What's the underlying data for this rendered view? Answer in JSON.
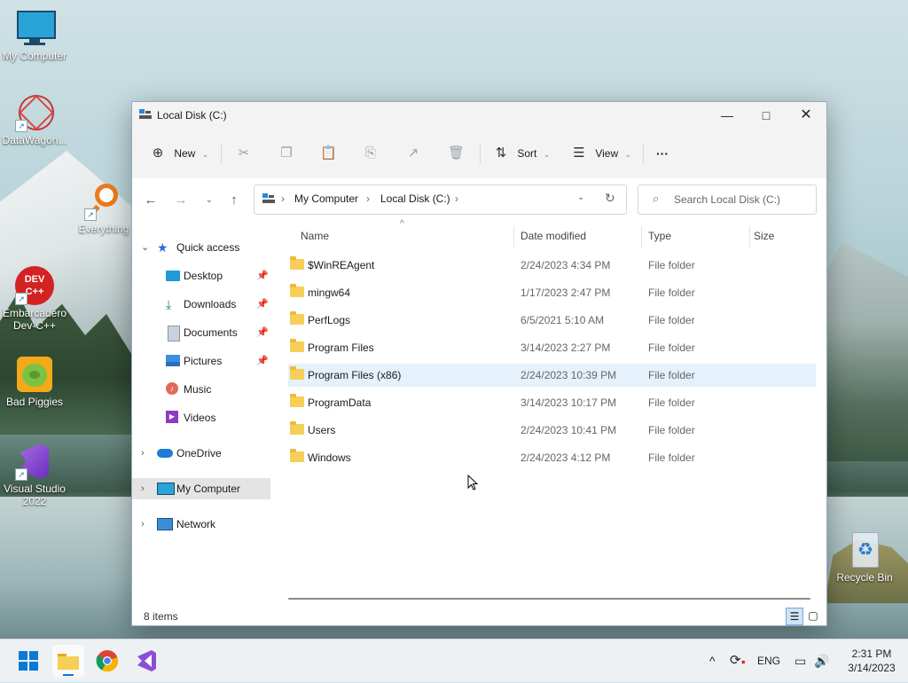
{
  "desktop": {
    "icons": [
      {
        "label": "My Computer"
      },
      {
        "label": "DataWagon..."
      },
      {
        "label": "Everything"
      },
      {
        "label": "Embarcadero Dev-C++"
      },
      {
        "label": "Bad Piggies"
      },
      {
        "label": "Visual Studio 2022"
      },
      {
        "label": "Recycle Bin"
      }
    ]
  },
  "window": {
    "title": "Local Disk (C:)",
    "toolbar": {
      "new_label": "New",
      "sort_label": "Sort",
      "view_label": "View",
      "more_label": "···"
    },
    "address": {
      "crumbs": [
        "My Computer",
        "Local Disk (C:)"
      ],
      "search_placeholder": "Search Local Disk (C:)"
    },
    "sidebar": {
      "quick_access": "Quick access",
      "items": [
        {
          "label": "Desktop",
          "pinned": true
        },
        {
          "label": "Downloads",
          "pinned": true
        },
        {
          "label": "Documents",
          "pinned": true
        },
        {
          "label": "Pictures",
          "pinned": true
        },
        {
          "label": "Music",
          "pinned": false
        },
        {
          "label": "Videos",
          "pinned": false
        }
      ],
      "onedrive": "OneDrive",
      "my_computer": "My Computer",
      "network": "Network"
    },
    "columns": [
      "Name",
      "Date modified",
      "Type",
      "Size"
    ],
    "rows": [
      {
        "name": "$WinREAgent",
        "date": "2/24/2023 4:34 PM",
        "type": "File folder"
      },
      {
        "name": "mingw64",
        "date": "1/17/2023 2:47 PM",
        "type": "File folder"
      },
      {
        "name": "PerfLogs",
        "date": "6/5/2021 5:10 AM",
        "type": "File folder"
      },
      {
        "name": "Program Files",
        "date": "3/14/2023 2:27 PM",
        "type": "File folder"
      },
      {
        "name": "Program Files (x86)",
        "date": "2/24/2023 10:39 PM",
        "type": "File folder"
      },
      {
        "name": "ProgramData",
        "date": "3/14/2023 10:17 PM",
        "type": "File folder"
      },
      {
        "name": "Users",
        "date": "2/24/2023 10:41 PM",
        "type": "File folder"
      },
      {
        "name": "Windows",
        "date": "2/24/2023 4:12 PM",
        "type": "File folder"
      }
    ],
    "status": "8 items"
  },
  "taskbar": {
    "lang": "ENG",
    "time": "2:31 PM",
    "date": "3/14/2023"
  },
  "colors": {
    "accent": "#0067c0",
    "folder": "#f6cf57",
    "hover_row": "#e5f1fb"
  }
}
